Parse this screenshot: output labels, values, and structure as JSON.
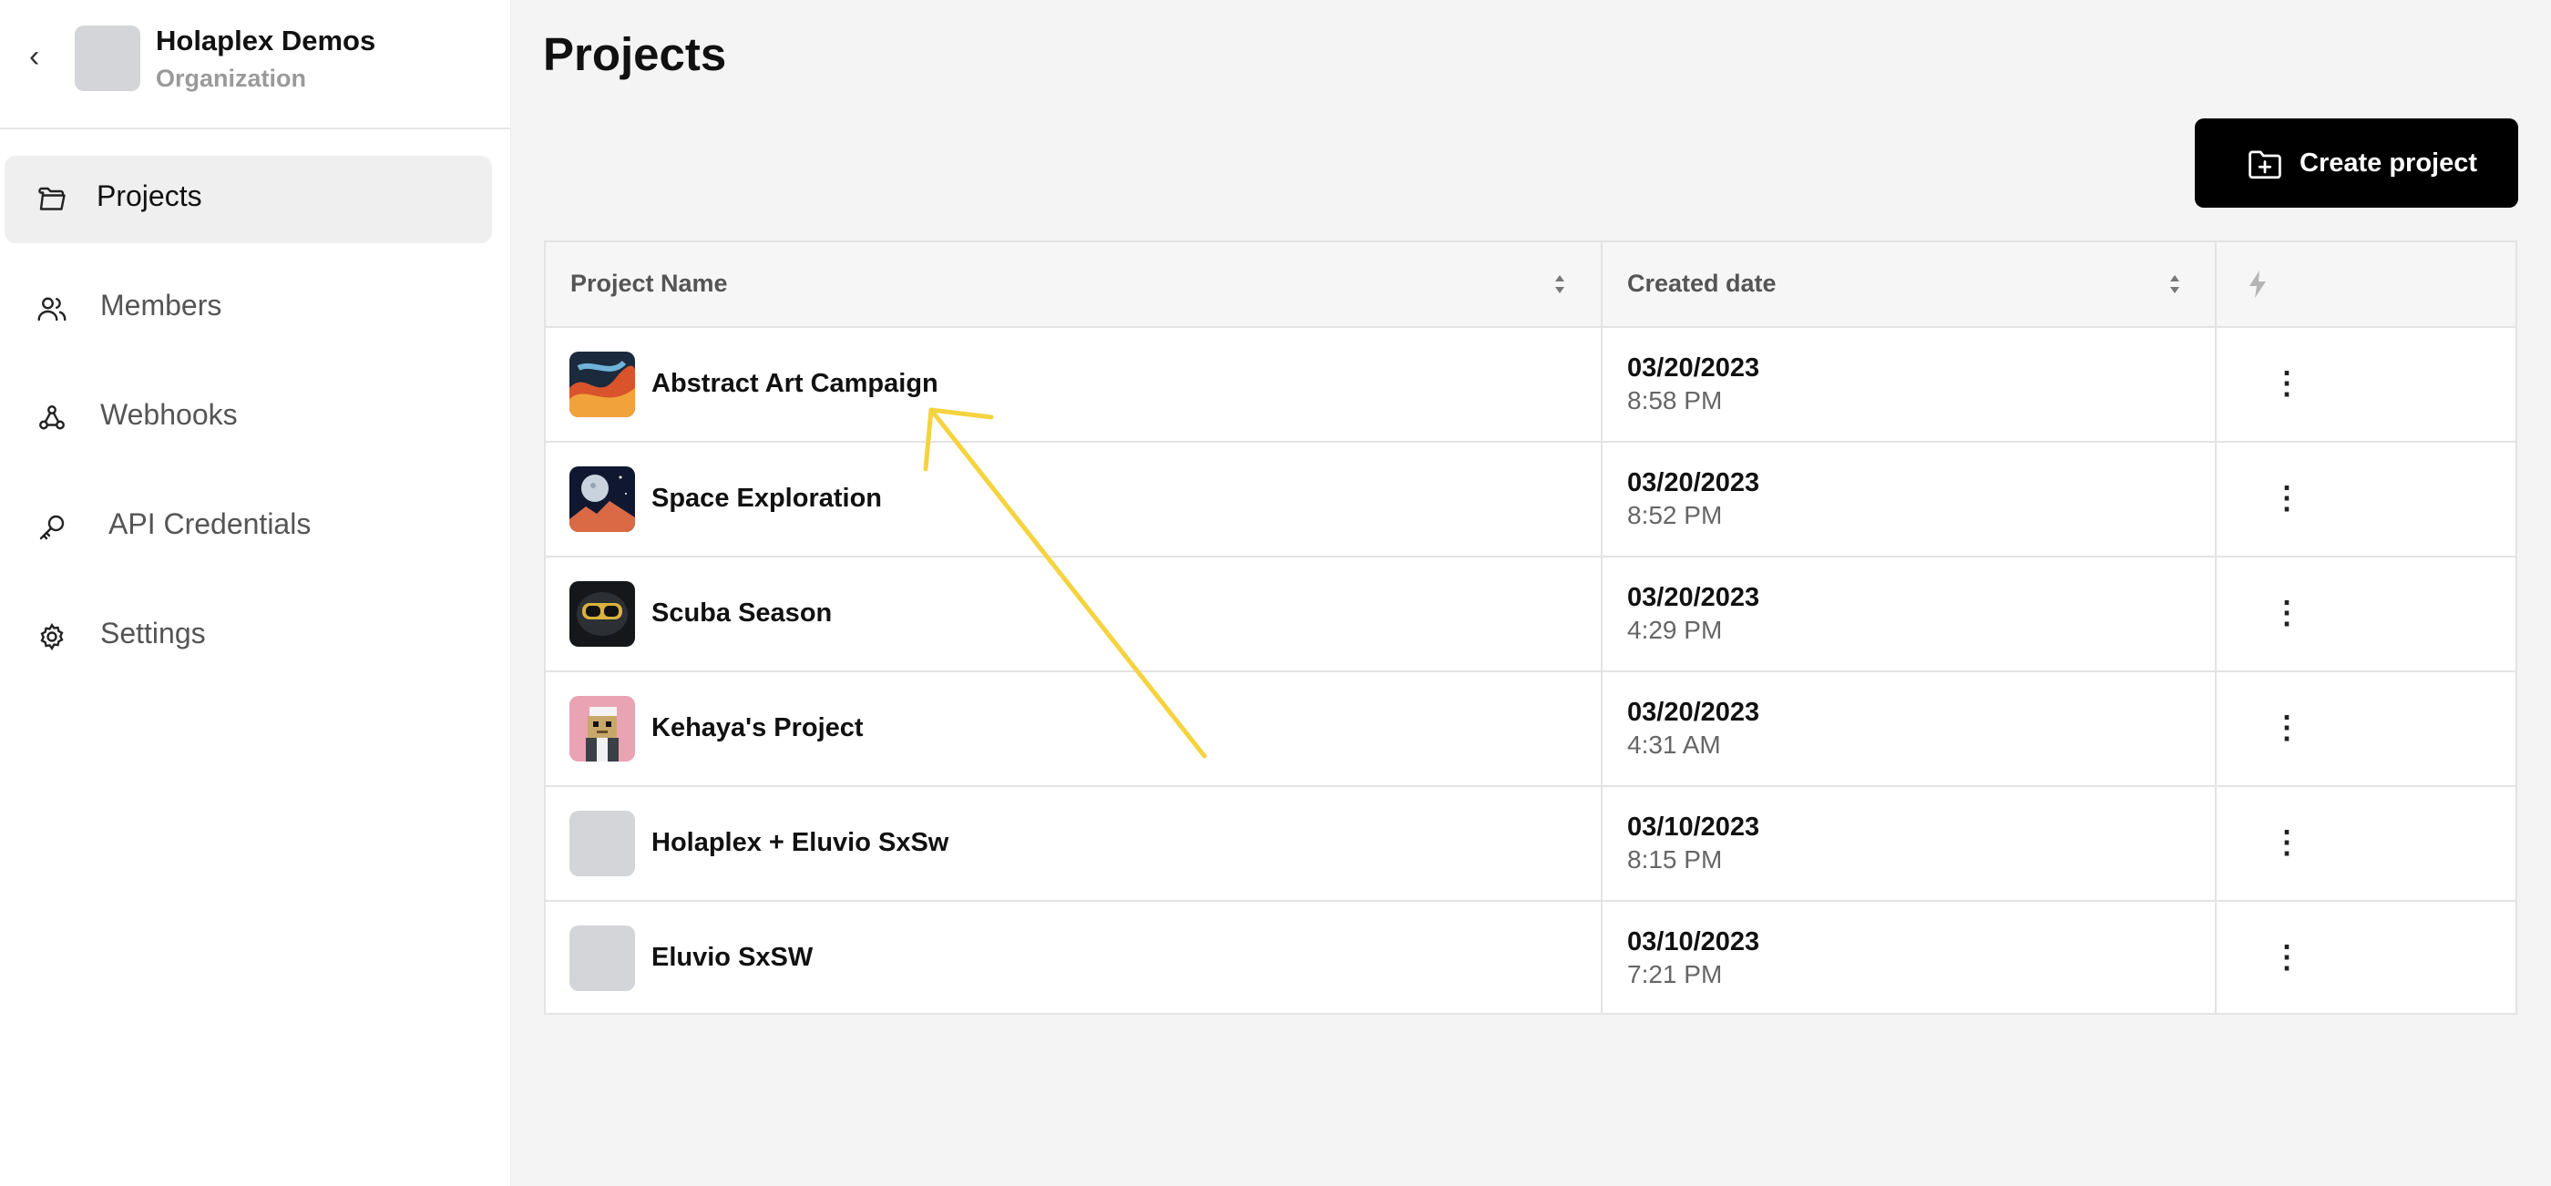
{
  "org": {
    "name": "Holaplex Demos",
    "type": "Organization"
  },
  "nav": [
    {
      "label": "Projects",
      "icon": "folder-icon",
      "active": true
    },
    {
      "label": "Members",
      "icon": "users-icon",
      "active": false
    },
    {
      "label": "Webhooks",
      "icon": "webhook-icon",
      "active": false
    },
    {
      "label": "API Credentials",
      "icon": "key-icon",
      "active": false
    },
    {
      "label": "Settings",
      "icon": "gear-icon",
      "active": false
    }
  ],
  "page": {
    "title": "Projects",
    "create_label": "Create project"
  },
  "table": {
    "headers": {
      "name": "Project Name",
      "created": "Created date"
    },
    "rows": [
      {
        "name": "Abstract Art Campaign",
        "date": "03/20/2023",
        "time": "8:58 PM"
      },
      {
        "name": "Space Exploration",
        "date": "03/20/2023",
        "time": "8:52 PM"
      },
      {
        "name": "Scuba Season",
        "date": "03/20/2023",
        "time": "4:29 PM"
      },
      {
        "name": "Kehaya's Project",
        "date": "03/20/2023",
        "time": "4:31 AM"
      },
      {
        "name": "Holaplex + Eluvio SxSw",
        "date": "03/10/2023",
        "time": "8:15 PM"
      },
      {
        "name": "Eluvio SxSW",
        "date": "03/10/2023",
        "time": "7:21 PM"
      }
    ]
  },
  "colors": {
    "accent": "#000000",
    "annotation": "#f5d33f",
    "avatar_placeholder": "#d4d5d8"
  }
}
